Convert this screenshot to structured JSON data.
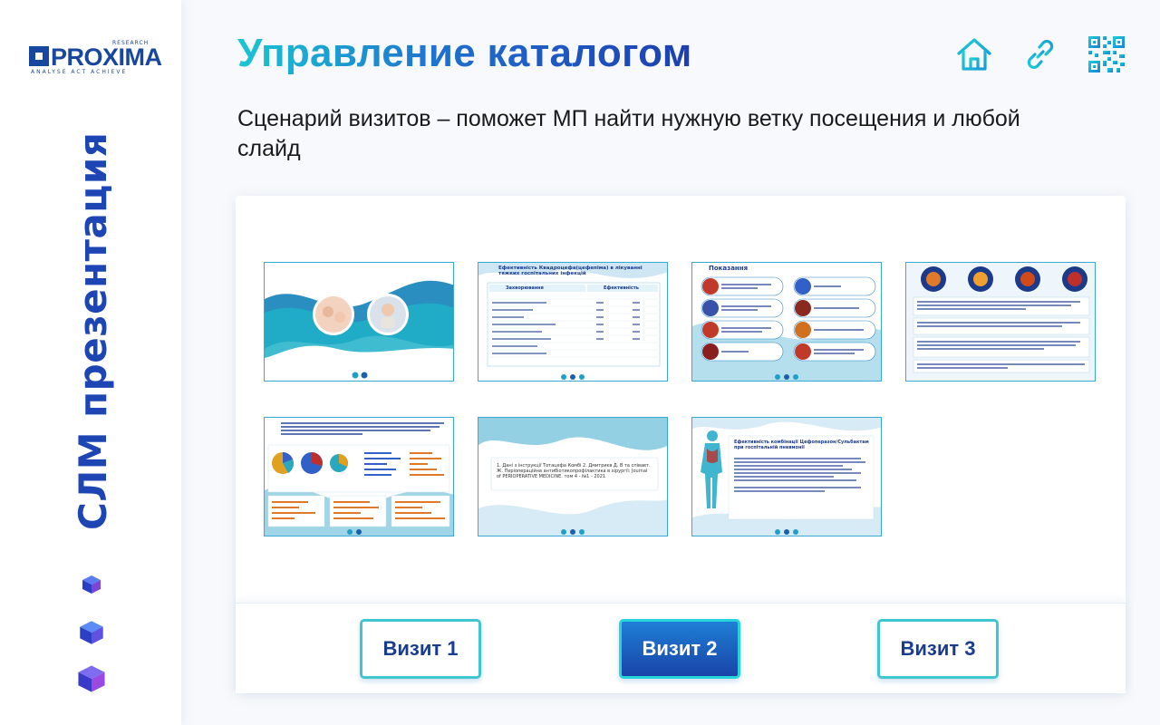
{
  "sidebar": {
    "logo": {
      "research": "RESEARCH",
      "name": "PROXIMA",
      "tagline": "ANALYSE ACT ACHIEVE"
    },
    "vertical_title": "СЛМ презентация",
    "icons": [
      "cube-small-icon",
      "cube-medium-icon",
      "cube-large-icon"
    ]
  },
  "header": {
    "title": "Управление каталогом",
    "subtitle": "Сценарий визитов – поможет МП найти нужную ветку посещения и любой слайд",
    "icons": [
      "home-icon",
      "link-icon",
      "qr-code-icon"
    ]
  },
  "slides": [
    {
      "name": "slide-thumb-1",
      "kind": "photo-title"
    },
    {
      "name": "slide-thumb-2",
      "kind": "table",
      "title": "Ефективність Квадроцефа(цефепіма) в лікуванні тяжких госпітальних інфекцій",
      "col1": "Захворювання",
      "col2": "Ефективність"
    },
    {
      "name": "slide-thumb-3",
      "kind": "indications",
      "title": "Показання"
    },
    {
      "name": "slide-thumb-4",
      "kind": "organs-text"
    },
    {
      "name": "slide-thumb-5",
      "kind": "charts"
    },
    {
      "name": "slide-thumb-6",
      "kind": "references",
      "text": "1. Дані з інструкції Тотацефа Комбі 2. Дмитриєв Д. В та співавт. Ж. Періопераційна антибіотикопрофілактика в хірургії: Journal of PERIOPERATIVE MEDICINE. том 4 - №1 - 2021"
    },
    {
      "name": "slide-thumb-7",
      "kind": "body",
      "title": "Ефективність комбінації Цефоперазон/Сульбактам при госпітальній пневмонії"
    }
  ],
  "visits": [
    {
      "label": "Визит 1",
      "active": false
    },
    {
      "label": "Визит 2",
      "active": true
    },
    {
      "label": "Визит 3",
      "active": false
    }
  ],
  "colors": {
    "accent": "#1e45b4",
    "teal": "#19c6d3",
    "active_button": "#1944a8"
  }
}
